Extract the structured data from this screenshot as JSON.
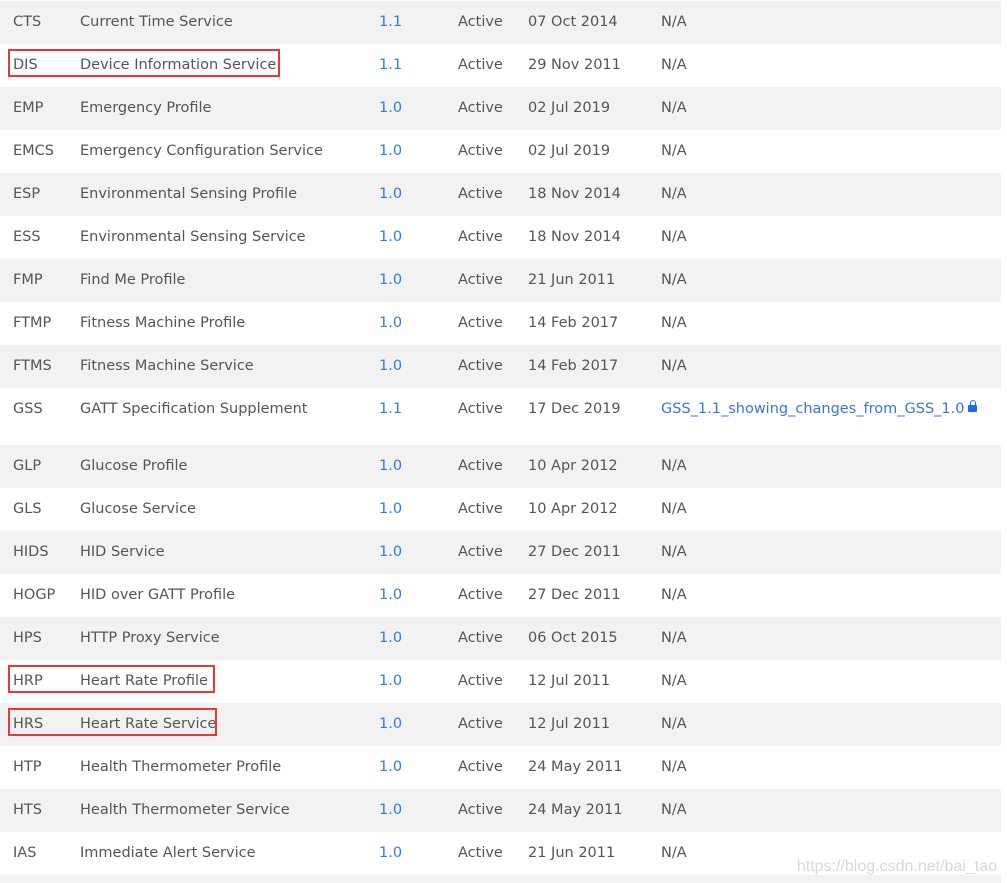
{
  "rows": [
    {
      "code": "CTS",
      "name": "Current Time Service",
      "version": "1.1",
      "status": "Active",
      "date": "07 Oct 2014",
      "doc": "N/A"
    },
    {
      "code": "DIS",
      "name": "Device Information Service",
      "version": "1.1",
      "status": "Active",
      "date": "29 Nov 2011",
      "doc": "N/A",
      "highlighted": true
    },
    {
      "code": "EMP",
      "name": "Emergency Profile",
      "version": "1.0",
      "status": "Active",
      "date": "02 Jul 2019",
      "doc": "N/A"
    },
    {
      "code": "EMCS",
      "name": "Emergency Configuration Service",
      "version": "1.0",
      "status": "Active",
      "date": "02 Jul 2019",
      "doc": "N/A"
    },
    {
      "code": "ESP",
      "name": "Environmental Sensing Profile",
      "version": "1.0",
      "status": "Active",
      "date": "18 Nov 2014",
      "doc": "N/A"
    },
    {
      "code": "ESS",
      "name": "Environmental Sensing Service",
      "version": "1.0",
      "status": "Active",
      "date": "18 Nov 2014",
      "doc": "N/A"
    },
    {
      "code": "FMP",
      "name": "Find Me Profile",
      "version": "1.0",
      "status": "Active",
      "date": "21 Jun 2011",
      "doc": "N/A"
    },
    {
      "code": "FTMP",
      "name": "Fitness Machine Profile",
      "version": "1.0",
      "status": "Active",
      "date": "14 Feb 2017",
      "doc": "N/A"
    },
    {
      "code": "FTMS",
      "name": "Fitness Machine Service",
      "version": "1.0",
      "status": "Active",
      "date": "14 Feb 2017",
      "doc": "N/A"
    },
    {
      "code": "GSS",
      "name": "GATT Specification Supplement",
      "version": "1.1",
      "status": "Active",
      "date": "17 Dec 2019",
      "doc": "GSS_1.1_showing_changes_from_GSS_1.0",
      "doc_link": true,
      "doc_icon": "lock-icon"
    },
    {
      "code": "GLP",
      "name": "Glucose Profile",
      "version": "1.0",
      "status": "Active",
      "date": "10 Apr 2012",
      "doc": "N/A"
    },
    {
      "code": "GLS",
      "name": "Glucose Service",
      "version": "1.0",
      "status": "Active",
      "date": "10 Apr 2012",
      "doc": "N/A"
    },
    {
      "code": "HIDS",
      "name": "HID Service",
      "version": "1.0",
      "status": "Active",
      "date": "27 Dec 2011",
      "doc": "N/A"
    },
    {
      "code": "HOGP",
      "name": "HID over GATT Profile",
      "version": "1.0",
      "status": "Active",
      "date": "27 Dec 2011",
      "doc": "N/A"
    },
    {
      "code": "HPS",
      "name": "HTTP Proxy Service",
      "version": "1.0",
      "status": "Active",
      "date": "06 Oct 2015",
      "doc": "N/A"
    },
    {
      "code": "HRP",
      "name": "Heart Rate Profile",
      "version": "1.0",
      "status": "Active",
      "date": "12 Jul 2011",
      "doc": "N/A",
      "highlighted": true
    },
    {
      "code": "HRS",
      "name": "Heart Rate Service",
      "version": "1.0",
      "status": "Active",
      "date": "12 Jul 2011",
      "doc": "N/A",
      "highlighted": true
    },
    {
      "code": "HTP",
      "name": "Health Thermometer Profile",
      "version": "1.0",
      "status": "Active",
      "date": "24 May 2011",
      "doc": "N/A"
    },
    {
      "code": "HTS",
      "name": "Health Thermometer Service",
      "version": "1.0",
      "status": "Active",
      "date": "24 May 2011",
      "doc": "N/A"
    },
    {
      "code": "IAS",
      "name": "Immediate Alert Service",
      "version": "1.0",
      "status": "Active",
      "date": "21 Jun 2011",
      "doc": "N/A"
    }
  ],
  "colors": {
    "link": "#3b73e6",
    "row_alt": "#f2f2f2",
    "highlight": "#e8373a"
  },
  "watermark": "https://blog.csdn.net/bai_tao"
}
